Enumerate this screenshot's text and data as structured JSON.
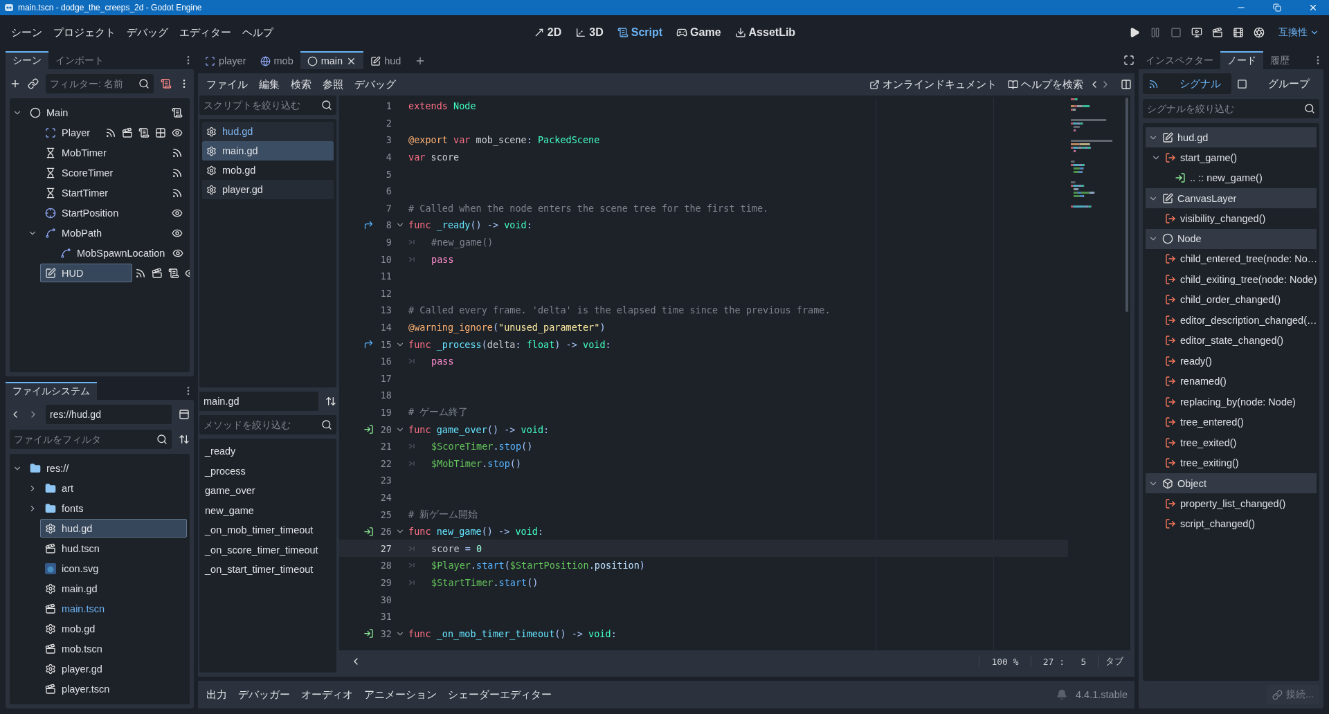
{
  "window": {
    "title": "main.tscn - dodge_the_creeps_2d - Godot Engine"
  },
  "menu": [
    "シーン",
    "プロジェクト",
    "デバッグ",
    "エディター",
    "ヘルプ"
  ],
  "workspaces": [
    {
      "label": "2D",
      "kind": "flat",
      "selected": false
    },
    {
      "label": "3D",
      "kind": "spatial",
      "selected": false
    },
    {
      "label": "Script",
      "kind": "script",
      "selected": true
    },
    {
      "label": "Game",
      "kind": "game",
      "selected": false
    },
    {
      "label": "AssetLib",
      "kind": "assetlib",
      "selected": false
    }
  ],
  "renderer": "互換性",
  "scene_dock": {
    "tabs": [
      {
        "label": "シーン",
        "selected": true
      },
      {
        "label": "インポート",
        "selected": false
      }
    ],
    "filter": {
      "placeholder": "フィルター: 名前"
    },
    "tree": [
      {
        "name": "Main",
        "kind": "node",
        "indicators": [
          {
            "kind": "script"
          }
        ],
        "selected": false,
        "expanded": true,
        "children": [
          {
            "name": "Player",
            "kind": "area",
            "indicators": [
              {
                "kind": "signals"
              },
              {
                "kind": "groups"
              },
              {
                "kind": "script"
              },
              {
                "kind": "selectable"
              },
              {
                "kind": "visible"
              }
            ],
            "selected": false
          },
          {
            "name": "MobTimer",
            "kind": "timer",
            "indicators": [
              {
                "kind": "signals"
              }
            ],
            "selected": false
          },
          {
            "name": "ScoreTimer",
            "kind": "timer",
            "indicators": [
              {
                "kind": "signals"
              }
            ],
            "selected": false
          },
          {
            "name": "StartTimer",
            "kind": "timer",
            "indicators": [
              {
                "kind": "signals"
              }
            ],
            "selected": false
          },
          {
            "name": "StartPosition",
            "kind": "marker",
            "indicators": [
              {
                "kind": "visible"
              }
            ],
            "selected": false
          },
          {
            "name": "MobPath",
            "kind": "path",
            "indicators": [
              {
                "kind": "visible"
              }
            ],
            "selected": false,
            "expanded": true,
            "children": [
              {
                "name": "MobSpawnLocation",
                "kind": "pathfollow",
                "indicators": [
                  {
                    "kind": "visible"
                  }
                ],
                "selected": false
              }
            ]
          },
          {
            "name": "HUD",
            "kind": "canvaslayer",
            "indicators": [
              {
                "kind": "signals"
              },
              {
                "kind": "groups"
              },
              {
                "kind": "script"
              },
              {
                "kind": "visible"
              }
            ],
            "selected": true
          }
        ]
      }
    ]
  },
  "file_dock": {
    "tab": "ファイルシステム",
    "path": "res://hud.gd",
    "filter": {
      "placeholder": "ファイルをフィルタ"
    },
    "tree": [
      {
        "name": "res://",
        "kind": "folder",
        "selected": false,
        "open": false,
        "expanded": true,
        "children": [
          {
            "name": "art",
            "kind": "folder",
            "selected": false,
            "open": false,
            "expanded": false
          },
          {
            "name": "fonts",
            "kind": "folder",
            "selected": false,
            "open": false,
            "expanded": false
          },
          {
            "name": "hud.gd",
            "kind": "script",
            "selected": true,
            "open": false
          },
          {
            "name": "hud.tscn",
            "kind": "scene",
            "selected": false,
            "open": false
          },
          {
            "name": "icon.svg",
            "kind": "image",
            "selected": false,
            "open": false
          },
          {
            "name": "main.gd",
            "kind": "script",
            "selected": false,
            "open": false
          },
          {
            "name": "main.tscn",
            "kind": "scene",
            "selected": false,
            "open": true
          },
          {
            "name": "mob.gd",
            "kind": "script",
            "selected": false,
            "open": false
          },
          {
            "name": "mob.tscn",
            "kind": "scene",
            "selected": false,
            "open": false
          },
          {
            "name": "player.gd",
            "kind": "script",
            "selected": false,
            "open": false
          },
          {
            "name": "player.tscn",
            "kind": "scene",
            "selected": false,
            "open": false
          }
        ]
      }
    ]
  },
  "script_tabs": [
    {
      "label": "player",
      "kind": "area",
      "selected": false
    },
    {
      "label": "mob",
      "kind": "rigid",
      "selected": false
    },
    {
      "label": "main",
      "kind": "node",
      "selected": true
    },
    {
      "label": "hud",
      "kind": "canvaslayer",
      "selected": false
    }
  ],
  "script_menu": [
    "ファイル",
    "編集",
    "検索",
    "参照",
    "デバッグ"
  ],
  "help_links": [
    {
      "label": "オンラインドキュメント",
      "kind": "docs"
    },
    {
      "label": "ヘルプを検索",
      "kind": "search"
    }
  ],
  "script_list": {
    "filter": {
      "placeholder": "スクリプトを絞り込む"
    },
    "items": [
      {
        "name": "hud.gd",
        "selected": false,
        "highlighted": true
      },
      {
        "name": "main.gd",
        "selected": true,
        "highlighted": false
      },
      {
        "name": "mob.gd",
        "selected": false,
        "highlighted": false
      },
      {
        "name": "player.gd",
        "selected": false,
        "highlighted": false
      }
    ]
  },
  "current_script": "main.gd",
  "methods": {
    "filter": {
      "placeholder": "メソッドを絞り込む"
    },
    "items": [
      "_ready",
      "_process",
      "game_over",
      "new_game",
      "_on_mob_timer_timeout",
      "_on_score_timer_timeout",
      "_on_start_timer_timeout"
    ]
  },
  "code": {
    "lines": [
      {
        "n": "1",
        "current": false,
        "fold": false,
        "indented": false,
        "tokens": [
          {
            "kind": "kw",
            "text": "extends"
          },
          {
            "kind": "ty",
            "text": " Node"
          }
        ]
      },
      {
        "n": "2",
        "current": false,
        "fold": false,
        "indented": false
      },
      {
        "n": "3",
        "current": false,
        "fold": false,
        "indented": false,
        "tokens": [
          {
            "kind": "an",
            "text": "@export"
          },
          {
            "kind": "kw",
            "text": " var"
          },
          {
            "kind": "p",
            "text": " mob_scene"
          },
          {
            "kind": "sy",
            "text": ":"
          },
          {
            "kind": "ty",
            "text": " PackedScene"
          }
        ]
      },
      {
        "n": "4",
        "current": false,
        "fold": false,
        "indented": false,
        "tokens": [
          {
            "kind": "kw",
            "text": "var"
          },
          {
            "kind": "p",
            "text": " score"
          }
        ]
      },
      {
        "n": "5",
        "current": false,
        "fold": false,
        "indented": false
      },
      {
        "n": "6",
        "current": false,
        "fold": false,
        "indented": false
      },
      {
        "n": "7",
        "current": false,
        "fold": false,
        "indented": false,
        "tokens": [
          {
            "kind": "c",
            "text": "# Called when the node enters the scene tree for the first time."
          }
        ]
      },
      {
        "n": "8",
        "current": false,
        "fold": true,
        "indented": false,
        "marker": {
          "kind": "override"
        },
        "tokens": [
          {
            "kind": "kw",
            "text": "func"
          },
          {
            "kind": "fd",
            "text": " _ready"
          },
          {
            "kind": "sy",
            "text": "() -> "
          },
          {
            "kind": "ty",
            "text": "void"
          },
          {
            "kind": "sy",
            "text": ":"
          }
        ]
      },
      {
        "n": "9",
        "current": false,
        "fold": false,
        "indented": true,
        "tokens": [
          {
            "kind": "c",
            "text": "#new_game()"
          }
        ]
      },
      {
        "n": "10",
        "current": false,
        "fold": false,
        "indented": true,
        "tokens": [
          {
            "kind": "cf",
            "text": "pass"
          }
        ]
      },
      {
        "n": "11",
        "current": false,
        "fold": false,
        "indented": false
      },
      {
        "n": "12",
        "current": false,
        "fold": false,
        "indented": false
      },
      {
        "n": "13",
        "current": false,
        "fold": false,
        "indented": false,
        "tokens": [
          {
            "kind": "c",
            "text": "# Called every frame. 'delta' is the elapsed time since the previous frame."
          }
        ]
      },
      {
        "n": "14",
        "current": false,
        "fold": false,
        "indented": false,
        "tokens": [
          {
            "kind": "an",
            "text": "@warning_ignore"
          },
          {
            "kind": "sy",
            "text": "("
          },
          {
            "kind": "st",
            "text": "\"unused_parameter\""
          },
          {
            "kind": "sy",
            "text": ")"
          }
        ]
      },
      {
        "n": "15",
        "current": false,
        "fold": true,
        "indented": false,
        "marker": {
          "kind": "override"
        },
        "tokens": [
          {
            "kind": "kw",
            "text": "func"
          },
          {
            "kind": "fd",
            "text": " _process"
          },
          {
            "kind": "sy",
            "text": "("
          },
          {
            "kind": "p",
            "text": "delta"
          },
          {
            "kind": "sy",
            "text": ": "
          },
          {
            "kind": "ty",
            "text": "float"
          },
          {
            "kind": "sy",
            "text": ") -> "
          },
          {
            "kind": "ty",
            "text": "void"
          },
          {
            "kind": "sy",
            "text": ":"
          }
        ]
      },
      {
        "n": "16",
        "current": false,
        "fold": false,
        "indented": true,
        "tokens": [
          {
            "kind": "cf",
            "text": "pass"
          }
        ]
      },
      {
        "n": "17",
        "current": false,
        "fold": false,
        "indented": false
      },
      {
        "n": "18",
        "current": false,
        "fold": false,
        "indented": false
      },
      {
        "n": "19",
        "current": false,
        "fold": false,
        "indented": false,
        "tokens": [
          {
            "kind": "c",
            "text": "# ゲーム終了"
          }
        ]
      },
      {
        "n": "20",
        "current": false,
        "fold": true,
        "indented": false,
        "marker": {
          "kind": "slot"
        },
        "tokens": [
          {
            "kind": "kw",
            "text": "func"
          },
          {
            "kind": "fd",
            "text": " game_over"
          },
          {
            "kind": "sy",
            "text": "() -> "
          },
          {
            "kind": "ty",
            "text": "void"
          },
          {
            "kind": "sy",
            "text": ":"
          }
        ]
      },
      {
        "n": "21",
        "current": false,
        "fold": false,
        "indented": true,
        "tokens": [
          {
            "kind": "np",
            "text": "$ScoreTimer"
          },
          {
            "kind": "sy",
            "text": "."
          },
          {
            "kind": "fn",
            "text": "stop"
          },
          {
            "kind": "sy",
            "text": "()"
          }
        ]
      },
      {
        "n": "22",
        "current": false,
        "fold": false,
        "indented": true,
        "tokens": [
          {
            "kind": "np",
            "text": "$MobTimer"
          },
          {
            "kind": "sy",
            "text": "."
          },
          {
            "kind": "fn",
            "text": "stop"
          },
          {
            "kind": "sy",
            "text": "()"
          }
        ]
      },
      {
        "n": "23",
        "current": false,
        "fold": false,
        "indented": false
      },
      {
        "n": "24",
        "current": false,
        "fold": false,
        "indented": false
      },
      {
        "n": "25",
        "current": false,
        "fold": false,
        "indented": false,
        "tokens": [
          {
            "kind": "c",
            "text": "# 新ゲーム開始"
          }
        ]
      },
      {
        "n": "26",
        "current": false,
        "fold": true,
        "indented": false,
        "marker": {
          "kind": "slot"
        },
        "tokens": [
          {
            "kind": "kw",
            "text": "func"
          },
          {
            "kind": "fd",
            "text": " new_game"
          },
          {
            "kind": "sy",
            "text": "() -> "
          },
          {
            "kind": "ty",
            "text": "void"
          },
          {
            "kind": "sy",
            "text": ":"
          }
        ]
      },
      {
        "n": "27",
        "current": true,
        "fold": false,
        "indented": true,
        "tokens": [
          {
            "kind": "p",
            "text": "score"
          },
          {
            "kind": "sy",
            "text": " = "
          },
          {
            "kind": "nm",
            "text": "0"
          }
        ]
      },
      {
        "n": "28",
        "current": false,
        "fold": false,
        "indented": true,
        "tokens": [
          {
            "kind": "np",
            "text": "$Player"
          },
          {
            "kind": "sy",
            "text": "."
          },
          {
            "kind": "fn",
            "text": "start"
          },
          {
            "kind": "sy",
            "text": "("
          },
          {
            "kind": "np",
            "text": "$StartPosition"
          },
          {
            "kind": "sy",
            "text": "."
          },
          {
            "kind": "mb",
            "text": "position"
          },
          {
            "kind": "sy",
            "text": ")"
          }
        ]
      },
      {
        "n": "29",
        "current": false,
        "fold": false,
        "indented": true,
        "tokens": [
          {
            "kind": "np",
            "text": "$StartTimer"
          },
          {
            "kind": "sy",
            "text": "."
          },
          {
            "kind": "fn",
            "text": "start"
          },
          {
            "kind": "sy",
            "text": "()"
          }
        ]
      },
      {
        "n": "30",
        "current": false,
        "fold": false,
        "indented": false
      },
      {
        "n": "31",
        "current": false,
        "fold": false,
        "indented": false
      },
      {
        "n": "32",
        "current": false,
        "fold": true,
        "indented": false,
        "marker": {
          "kind": "slot"
        },
        "tokens": [
          {
            "kind": "kw",
            "text": "func"
          },
          {
            "kind": "fd",
            "text": " _on_mob_timer_timeout"
          },
          {
            "kind": "sy",
            "text": "() -> "
          },
          {
            "kind": "ty",
            "text": "void"
          },
          {
            "kind": "sy",
            "text": ":"
          }
        ]
      }
    ]
  },
  "status": {
    "zoom": "100 %",
    "position": "27 :   5",
    "indent_mode": "タブ"
  },
  "bottom_tabs": [
    "出力",
    "デバッガー",
    "オーディオ",
    "アニメーション",
    "シェーダーエディター"
  ],
  "version": "4.4.1.stable",
  "right_dock": {
    "tabs": [
      {
        "label": "インスペクター",
        "selected": false
      },
      {
        "label": "ノード",
        "selected": true
      },
      {
        "label": "履歴",
        "selected": false
      }
    ],
    "subtabs": [
      {
        "label": "シグナル",
        "kind": "signals",
        "selected": true
      },
      {
        "label": "グループ",
        "kind": "groups",
        "selected": false
      }
    ],
    "filter": {
      "placeholder": "シグナルを絞り込む"
    },
    "signals": [
      {
        "name": "hud.gd",
        "kind": "canvaslayer",
        "expanded": true,
        "children": [
          {
            "name": "start_game()",
            "kind": "signal",
            "expanded": true,
            "children": [
              {
                "name": ".. :: new_game()",
                "kind": "connection"
              }
            ]
          }
        ]
      },
      {
        "name": "CanvasLayer",
        "kind": "canvaslayer",
        "expanded": true,
        "children": [
          {
            "name": "visibility_changed()",
            "kind": "signal"
          }
        ]
      },
      {
        "name": "Node",
        "kind": "node",
        "expanded": true,
        "children": [
          {
            "name": "child_entered_tree(node: No…",
            "kind": "signal"
          },
          {
            "name": "child_exiting_tree(node: Node)",
            "kind": "signal"
          },
          {
            "name": "child_order_changed()",
            "kind": "signal"
          },
          {
            "name": "editor_description_changed(…",
            "kind": "signal"
          },
          {
            "name": "editor_state_changed()",
            "kind": "signal"
          },
          {
            "name": "ready()",
            "kind": "signal"
          },
          {
            "name": "renamed()",
            "kind": "signal"
          },
          {
            "name": "replacing_by(node: Node)",
            "kind": "signal"
          },
          {
            "name": "tree_entered()",
            "kind": "signal"
          },
          {
            "name": "tree_exited()",
            "kind": "signal"
          },
          {
            "name": "tree_exiting()",
            "kind": "signal"
          }
        ]
      },
      {
        "name": "Object",
        "kind": "object",
        "expanded": true,
        "children": [
          {
            "name": "property_list_changed()",
            "kind": "signal"
          },
          {
            "name": "script_changed()",
            "kind": "signal"
          }
        ]
      }
    ],
    "connect_button": {
      "label": "接続...",
      "disabled": true
    }
  }
}
